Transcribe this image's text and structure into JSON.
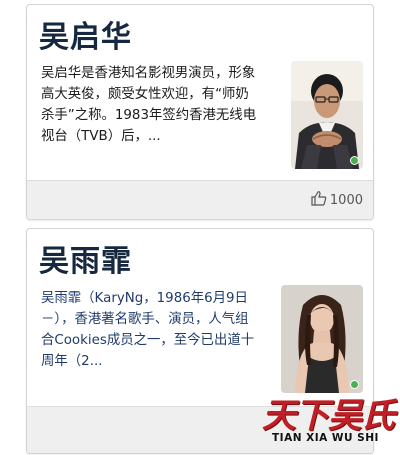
{
  "cards": [
    {
      "name": "吴启华",
      "desc_lines": [
        "吴启华是香港知名影视男演员，形象",
        "高大英俊，颇受女性欢迎，有“师奶",
        "杀手”之称。1983年签约香港无线电",
        "视台（TVB）后，..."
      ],
      "like_count": "1000",
      "text_color": "#1a1a1a",
      "photo_icon": "portrait-man"
    },
    {
      "name": "吴雨霏",
      "desc_lines": [
        "吴雨霏（KaryNg，1986年6月9日",
        "－），香港著名歌手、演员，人气组",
        "合Cookies成员之一，至今已出道十",
        "周年（2..."
      ],
      "like_count": "",
      "text_color": "#1f3b6b",
      "photo_icon": "portrait-woman"
    }
  ],
  "watermark": {
    "title": "天下吴氏",
    "pinyin": "TIAN XIA WU SHI",
    "color": "#c02025"
  }
}
